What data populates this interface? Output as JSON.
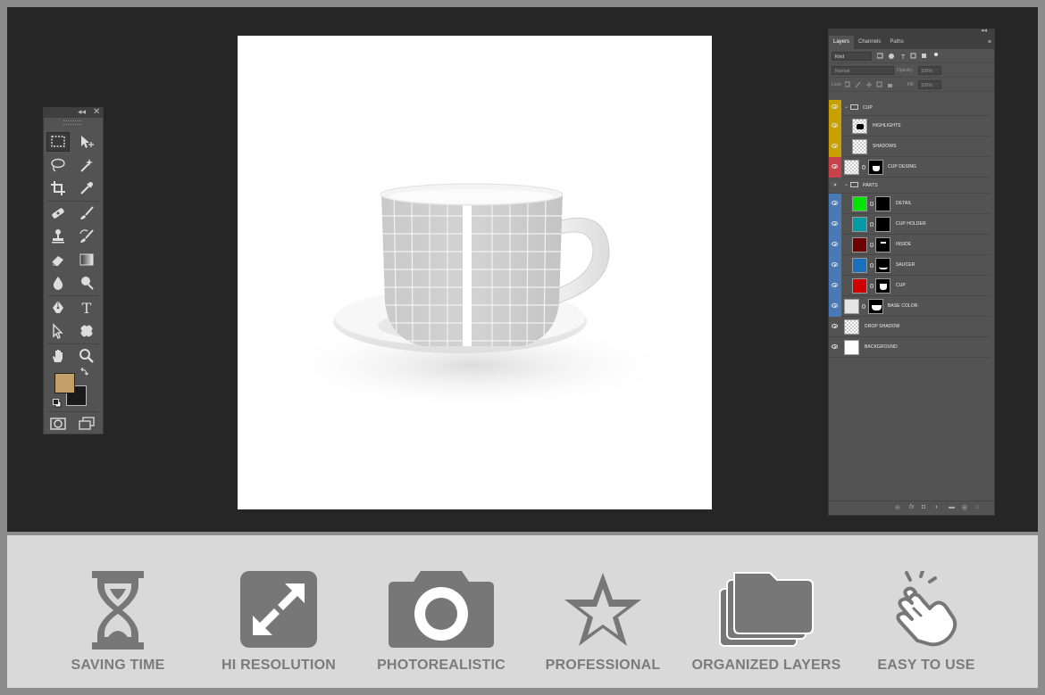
{
  "tools_panel": {
    "collapse_glyph": "◂◂",
    "close_glyph": "✕",
    "tools": [
      {
        "name": "rectangular-marquee-tool-icon"
      },
      {
        "name": "move-tool-icon"
      },
      {
        "name": "lasso-tool-icon"
      },
      {
        "name": "magic-wand-tool-icon"
      },
      {
        "name": "crop-tool-icon"
      },
      {
        "name": "eyedropper-tool-icon"
      },
      {
        "name": "spot-healing-tool-icon"
      },
      {
        "name": "brush-tool-icon"
      },
      {
        "name": "clone-stamp-tool-icon"
      },
      {
        "name": "history-brush-tool-icon"
      },
      {
        "name": "eraser-tool-icon"
      },
      {
        "name": "gradient-tool-icon"
      },
      {
        "name": "blur-tool-icon"
      },
      {
        "name": "dodge-tool-icon"
      },
      {
        "name": "pen-tool-icon"
      },
      {
        "name": "type-tool-icon"
      },
      {
        "name": "path-selection-tool-icon"
      },
      {
        "name": "custom-shape-tool-icon"
      },
      {
        "name": "hand-tool-icon"
      },
      {
        "name": "zoom-tool-icon"
      }
    ],
    "type_glyph": "T",
    "foreground_color": "#c4a068",
    "background_color": "#1a1a1a"
  },
  "layers_panel": {
    "tabs": [
      "Layers",
      "Channels",
      "Paths"
    ],
    "filter_kind": "Kind",
    "blend_mode": "Normal",
    "opacity_label": "Opacity:",
    "opacity_value": "100%",
    "lock_label": "Lock:",
    "fill_label": "Fill:",
    "fill_value": "100%",
    "layers": [
      {
        "name": "CUP",
        "type": "group",
        "color": "#c8a000"
      },
      {
        "name": "HIGHLIGHTS",
        "color": "#c8a000"
      },
      {
        "name": "SHADOWS",
        "color": "#c8a000"
      },
      {
        "name": "CUP DESING",
        "color": "#c8424a"
      },
      {
        "name": "PARTS",
        "type": "group",
        "color": ""
      },
      {
        "name": "DETAIL",
        "color": "#4a7ab5",
        "swatch": "#00e400"
      },
      {
        "name": "CUP HOLDER",
        "color": "#4a7ab5",
        "swatch": "#009aa5"
      },
      {
        "name": "INSIDE",
        "color": "#4a7ab5",
        "swatch": "#6d0000"
      },
      {
        "name": "SAUCER",
        "color": "#4a7ab5",
        "swatch": "#1b6fbf"
      },
      {
        "name": "CUP",
        "color": "#4a7ab5",
        "swatch": "#d00000"
      },
      {
        "name": "BASE COLOR",
        "color": "#4a7ab5"
      },
      {
        "name": "DROP SHADOW",
        "color": ""
      },
      {
        "name": "BACKGROUND",
        "color": ""
      }
    ],
    "bottom_icons": [
      "link-icon",
      "fx-icon",
      "mask-icon",
      "adjustment-icon",
      "folder-icon",
      "new-layer-icon",
      "trash-icon"
    ],
    "fx_glyph": "fx"
  },
  "features": [
    {
      "label": "SAVING TIME",
      "icon": "hourglass-icon"
    },
    {
      "label": "HI RESOLUTION",
      "icon": "expand-icon"
    },
    {
      "label": "PHOTOREALISTIC",
      "icon": "camera-icon"
    },
    {
      "label": "PROFESSIONAL",
      "icon": "star-icon"
    },
    {
      "label": "ORGANIZED LAYERS",
      "icon": "folders-icon"
    },
    {
      "label": "EASY TO USE",
      "icon": "tap-hand-icon"
    }
  ],
  "colors": {
    "workspace": "#262626",
    "panel": "#535353",
    "feature_bar": "#d9d9d9",
    "feature_icon": "#777777",
    "frame": "#8c8c8c"
  }
}
